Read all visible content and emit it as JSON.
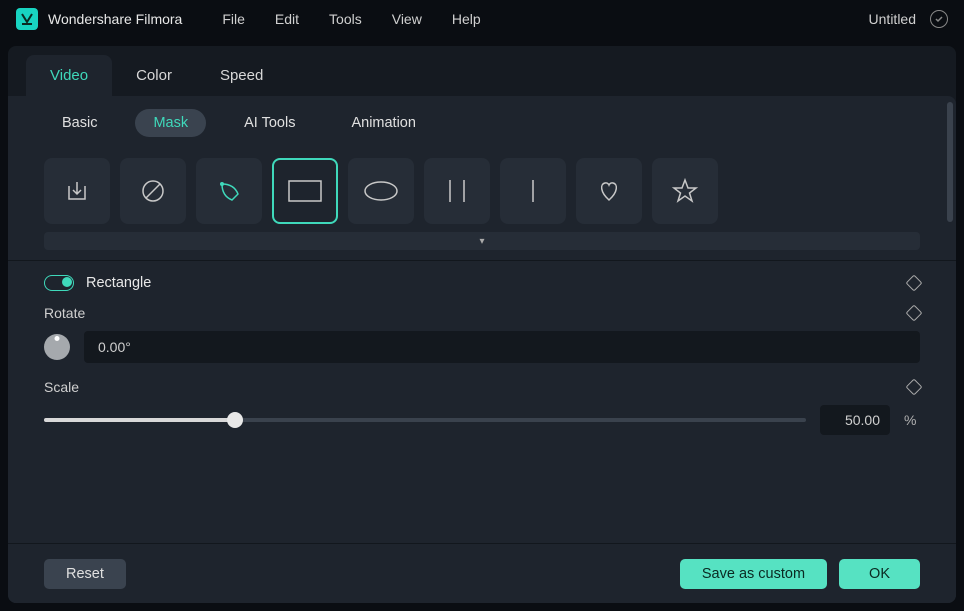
{
  "app_name": "Wondershare Filmora",
  "menus": [
    "File",
    "Edit",
    "Tools",
    "View",
    "Help"
  ],
  "doc_title": "Untitled",
  "main_tabs": [
    {
      "label": "Video",
      "active": true
    },
    {
      "label": "Color",
      "active": false
    },
    {
      "label": "Speed",
      "active": false
    }
  ],
  "sub_tabs": [
    {
      "label": "Basic",
      "active": false
    },
    {
      "label": "Mask",
      "active": true
    },
    {
      "label": "AI Tools",
      "active": false
    },
    {
      "label": "Animation",
      "active": false
    }
  ],
  "shapes": [
    {
      "name": "import-icon"
    },
    {
      "name": "none-icon"
    },
    {
      "name": "pen-icon"
    },
    {
      "name": "rectangle-icon",
      "selected": true
    },
    {
      "name": "ellipse-icon"
    },
    {
      "name": "double-line-icon"
    },
    {
      "name": "single-line-icon"
    },
    {
      "name": "heart-icon"
    },
    {
      "name": "star-icon"
    }
  ],
  "section": {
    "title": "Rectangle"
  },
  "rotate": {
    "label": "Rotate",
    "value": "0.00°"
  },
  "scale": {
    "label": "Scale",
    "value": "50.00",
    "unit": "%",
    "percent": 25
  },
  "buttons": {
    "reset": "Reset",
    "save_custom": "Save as custom",
    "ok": "OK"
  }
}
